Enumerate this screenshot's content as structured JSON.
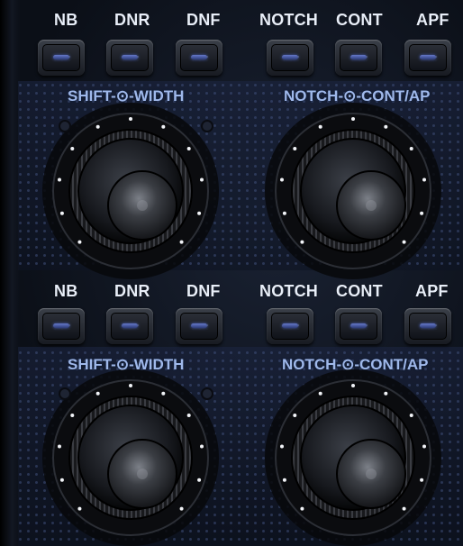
{
  "rows": [
    {
      "buttons": [
        {
          "label": "NB"
        },
        {
          "label": "DNR"
        },
        {
          "label": "DNF"
        },
        {
          "label": "NOTCH"
        },
        {
          "label": "CONT"
        },
        {
          "label": "APF"
        }
      ],
      "knob_labels": {
        "left": "SHIFT-⊙-WIDTH",
        "right": "NOTCH-⊙-CONT/AP"
      }
    },
    {
      "buttons": [
        {
          "label": "NB"
        },
        {
          "label": "DNR"
        },
        {
          "label": "DNF"
        },
        {
          "label": "NOTCH"
        },
        {
          "label": "CONT"
        },
        {
          "label": "APF"
        }
      ],
      "knob_labels": {
        "left": "SHIFT-⊙-WIDTH",
        "right": "NOTCH-⊙-CONT/AP"
      }
    }
  ],
  "colors": {
    "panel": "#0b0f17",
    "label_white": "#e8eef8",
    "label_blue": "#9fb8ea",
    "led_blue": "#6478c8"
  },
  "icons": {
    "knob": "rotary-knob-icon",
    "button_led": "led-indicator-icon"
  }
}
